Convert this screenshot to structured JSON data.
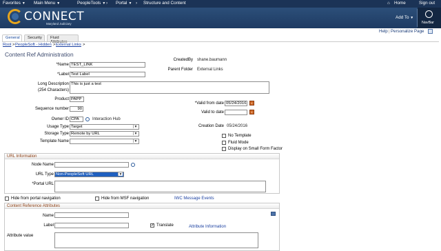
{
  "topbar": {
    "favorites": "Favorites",
    "main_menu": "Main Menu",
    "peopletools": "PeopleTools",
    "portal": "Portal",
    "structure": "Structure and Content",
    "home": "Home",
    "signout": "Sign out"
  },
  "header": {
    "logo": "CONNECT",
    "logo_sub": "Maryland Judiciary",
    "add_to": "Add To",
    "navbar": "NavBar"
  },
  "utility": {
    "help": "Help",
    "personalize": "Personalize Page"
  },
  "tabs": [
    "General",
    "Security",
    "Fluid Attributes"
  ],
  "breadcrumbs": [
    "Root",
    "PeopleSoft - Hidden",
    "External Links"
  ],
  "page_title": "Content Ref Administration",
  "form": {
    "name_label": "*Name",
    "name_value": "TEST_LINK",
    "label_label": "*Label",
    "label_value": "Test Label",
    "longdesc_label": "Long Description",
    "longdesc_hint": "(254 Characters)",
    "longdesc_value": "This is just a test",
    "product_label": "Product",
    "product_value": "PAPP",
    "seq_label": "Sequence number",
    "seq_value": "90",
    "owner_label": "Owner ID",
    "owner_value": "CPA",
    "owner_desc": "Interaction Hub",
    "usage_label": "Usage Type",
    "usage_value": "Target",
    "storage_label": "Storage Type",
    "storage_value": "Remote by URL",
    "template_label": "Template Name",
    "template_value": "",
    "createdby_label": "CreatedBy",
    "createdby_value": "shane.baumann",
    "parent_label": "Parent Folder",
    "parent_value": "External Links",
    "validfrom_label": "*Valid from date",
    "validfrom_value": "05/24/2016",
    "validto_label": "Valid to date",
    "validto_value": "",
    "creation_label": "Creation Date",
    "creation_value": "05/24/2016",
    "no_template": "No Template",
    "fluid_mode": "Fluid Mode",
    "display_small": "Display on Small Form Factor"
  },
  "url_info": {
    "title": "URL Information",
    "node_label": "Node Name",
    "node_value": "",
    "urltype_label": "URL Type",
    "urltype_value": "Non-PeopleSoft URL",
    "portalurl_label": "*Portal URL",
    "portalurl_value": ""
  },
  "nav_opts": {
    "hide_portal": "Hide from portal navigation",
    "hide_msf": "Hide from MSF navigation",
    "iwc_link": "IWC Message Events"
  },
  "cref_attrs": {
    "title": "Content Reference Attributes",
    "name_label": "Name",
    "name_value": "",
    "label_label": "Label",
    "label_value": "",
    "translate_label": "Translate",
    "translate_checked": true,
    "attr_info_link": "Attribute Information",
    "attrval_label": "Attribute value",
    "attrval_value": ""
  },
  "colors": {
    "topbar": "#1b3356",
    "header": "#2c4f79",
    "section_title": "#8a3d11",
    "link": "#1a3fa0",
    "url_type_selected": "#1f5fbf"
  }
}
